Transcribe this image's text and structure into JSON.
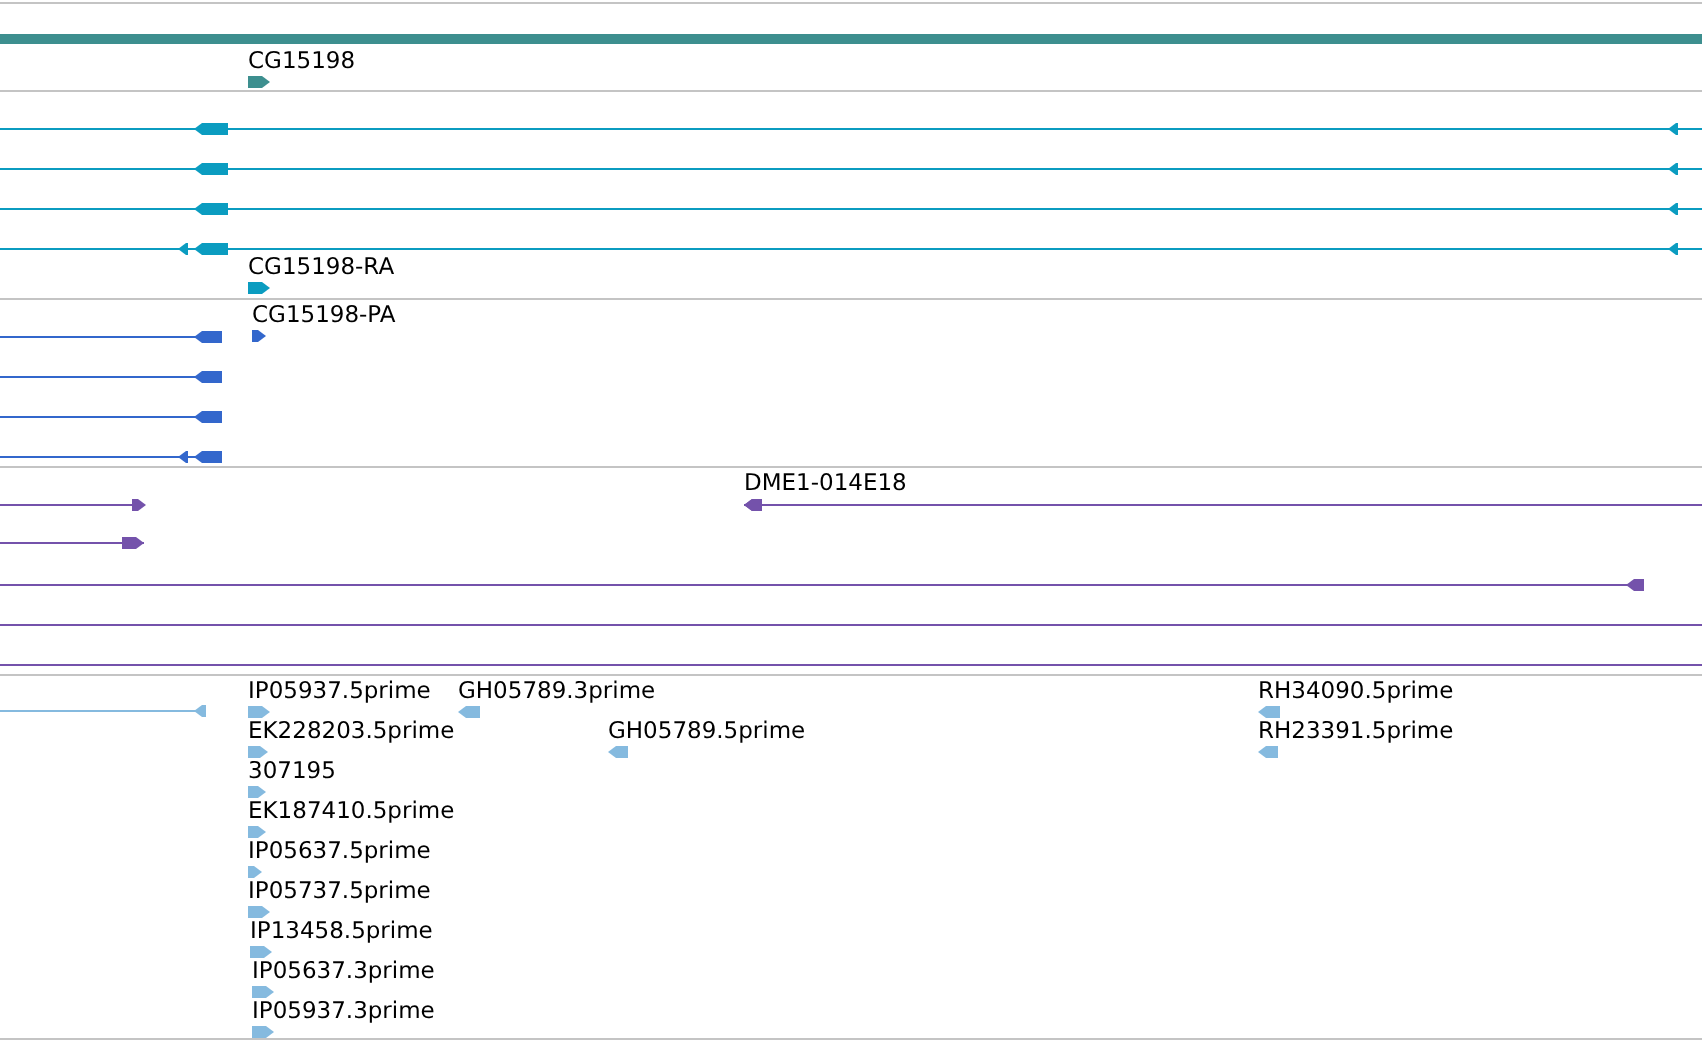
{
  "tracks": [
    {
      "color": "#3d8f8f",
      "features": [
        {
          "label": "CG15198",
          "reverse": false
        }
      ]
    },
    {
      "color": "#0b9cc0",
      "features": [
        {
          "label": "CG15198-RA",
          "reverse": false
        }
      ]
    },
    {
      "color": "#3367cc",
      "features": [
        {
          "label": "CG15198-PA",
          "reverse": false
        }
      ]
    },
    {
      "color": "#7452ab",
      "features": [
        {
          "label": "DME1-014E18",
          "reverse": true
        }
      ]
    },
    {
      "color": "#85badf",
      "features": [
        {
          "label": "IP05937.5prime",
          "reverse": false
        },
        {
          "label": "GH05789.3prime",
          "reverse": true
        },
        {
          "label": "RH34090.5prime",
          "reverse": true
        },
        {
          "label": "EK228203.5prime",
          "reverse": false
        },
        {
          "label": "GH05789.5prime",
          "reverse": true
        },
        {
          "label": "RH23391.5prime",
          "reverse": true
        },
        {
          "label": "307195",
          "reverse": false
        },
        {
          "label": "EK187410.5prime",
          "reverse": false
        },
        {
          "label": "IP05637.5prime",
          "reverse": false
        },
        {
          "label": "IP05737.5prime",
          "reverse": false
        },
        {
          "label": "IP13458.5prime",
          "reverse": false
        },
        {
          "label": "IP05637.3prime",
          "reverse": false
        },
        {
          "label": "IP05937.3prime",
          "reverse": false
        }
      ]
    }
  ]
}
